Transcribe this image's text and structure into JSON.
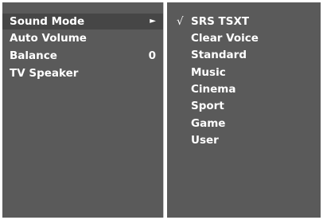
{
  "left_menu": {
    "items": [
      {
        "label": "Sound Mode",
        "indicator": "►",
        "selected": true
      },
      {
        "label": "Auto Volume",
        "indicator": "",
        "selected": false
      },
      {
        "label": "Balance",
        "indicator": "0",
        "selected": false
      },
      {
        "label": "TV Speaker",
        "indicator": "",
        "selected": false
      }
    ]
  },
  "right_menu": {
    "check_mark": "√",
    "options": [
      {
        "label": "SRS  TSXT",
        "checked": true
      },
      {
        "label": "Clear Voice",
        "checked": false
      },
      {
        "label": "Standard",
        "checked": false
      },
      {
        "label": "Music",
        "checked": false
      },
      {
        "label": "Cinema",
        "checked": false
      },
      {
        "label": "Sport",
        "checked": false
      },
      {
        "label": "Game",
        "checked": false
      },
      {
        "label": "User",
        "checked": false
      }
    ]
  },
  "colors": {
    "panel_bg": "#5a5a5a",
    "highlight_bg": "#464646",
    "text": "#ffffff",
    "divider": "#c8c8c8"
  }
}
